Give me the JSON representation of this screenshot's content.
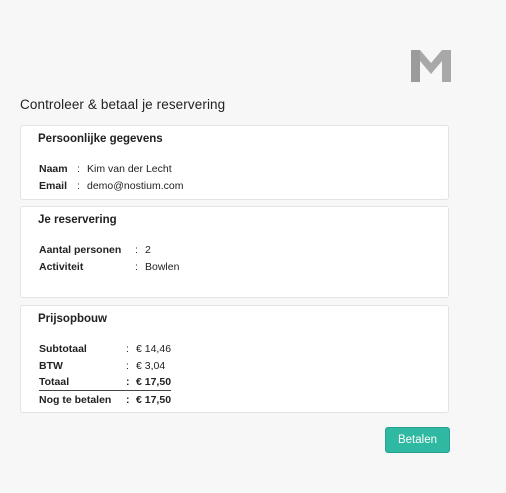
{
  "page_title": "Controleer & betaal je reservering",
  "logo_icon": "nostium-m-logo-icon",
  "personal": {
    "title": "Persoonlijke gegevens",
    "rows": [
      {
        "label": "Naam",
        "sep": ":",
        "value": "Kim van der Lecht"
      },
      {
        "label": "Email",
        "sep": ":",
        "value": "demo@nostium.com"
      }
    ]
  },
  "reservation": {
    "title": "Je reservering",
    "rows": [
      {
        "label": "Aantal personen",
        "sep": ":",
        "value": "2"
      },
      {
        "label": "Activiteit",
        "sep": ":",
        "value": "Bowlen"
      }
    ]
  },
  "pricing": {
    "title": "Prijsopbouw",
    "rows": [
      {
        "label": "Subtotaal",
        "sep": ":",
        "value": "€ 14,46"
      },
      {
        "label": "BTW",
        "sep": ":",
        "value": "€ 3,04"
      },
      {
        "label": "Totaal",
        "sep": ":",
        "value": "€ 17,50"
      },
      {
        "label": "Nog te betalen",
        "sep": ":",
        "value": "€ 17,50"
      }
    ]
  },
  "pay_button_label": "Betalen",
  "colors": {
    "accent": "#2fb8a2",
    "logo": "#a8a8a8",
    "background": "#f7f7f7"
  }
}
